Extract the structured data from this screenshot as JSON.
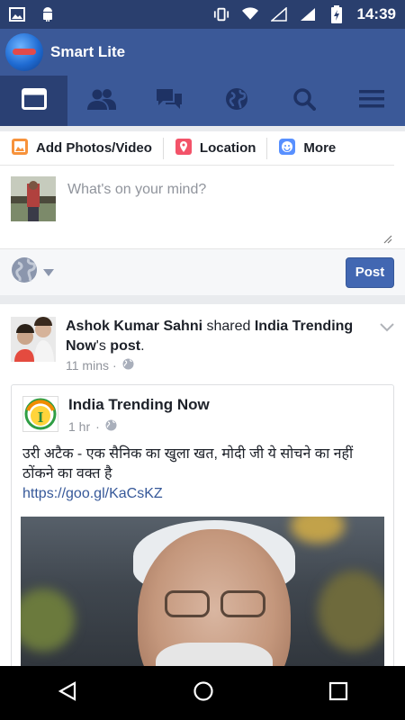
{
  "status_bar": {
    "time": "14:39",
    "left_icons": [
      "image-icon",
      "android-icon"
    ],
    "right_icons": [
      "vibrate-icon",
      "wifi-icon",
      "signal-icon",
      "signal-icon",
      "battery-icon"
    ]
  },
  "app": {
    "title": "Smart Lite",
    "brand_color": "#3b5998"
  },
  "nav_tabs": [
    {
      "name": "news-feed",
      "icon": "news-feed-icon",
      "active": true
    },
    {
      "name": "friends",
      "icon": "friends-icon",
      "active": false
    },
    {
      "name": "messages",
      "icon": "messages-icon",
      "active": false
    },
    {
      "name": "notifications",
      "icon": "globe-icon",
      "active": false
    },
    {
      "name": "search",
      "icon": "search-icon",
      "active": false
    },
    {
      "name": "menu",
      "icon": "menu-icon",
      "active": false
    }
  ],
  "composer": {
    "actions": [
      {
        "label": "Add Photos/Video",
        "icon": "photo-icon"
      },
      {
        "label": "Location",
        "icon": "location-icon"
      },
      {
        "label": "More",
        "icon": "smiley-icon"
      }
    ],
    "placeholder": "What's on your mind?",
    "post_label": "Post"
  },
  "story": {
    "actor": "Ashok Kumar Sahni",
    "verb": "shared",
    "page": "India Trending",
    "page_cont": "Now",
    "suffix": "'s",
    "object": "post",
    "end": ".",
    "time": "11 mins",
    "shared": {
      "page_name": "India Trending Now",
      "page_initial": "I",
      "time": "1 hr",
      "text": "उरी अटैक - एक सैनिक का खुला खत, मोदी जी ये सोचने का नहीं ठोंकने का वक्त है",
      "link": "https://goo.gl/KaCsKZ"
    }
  }
}
